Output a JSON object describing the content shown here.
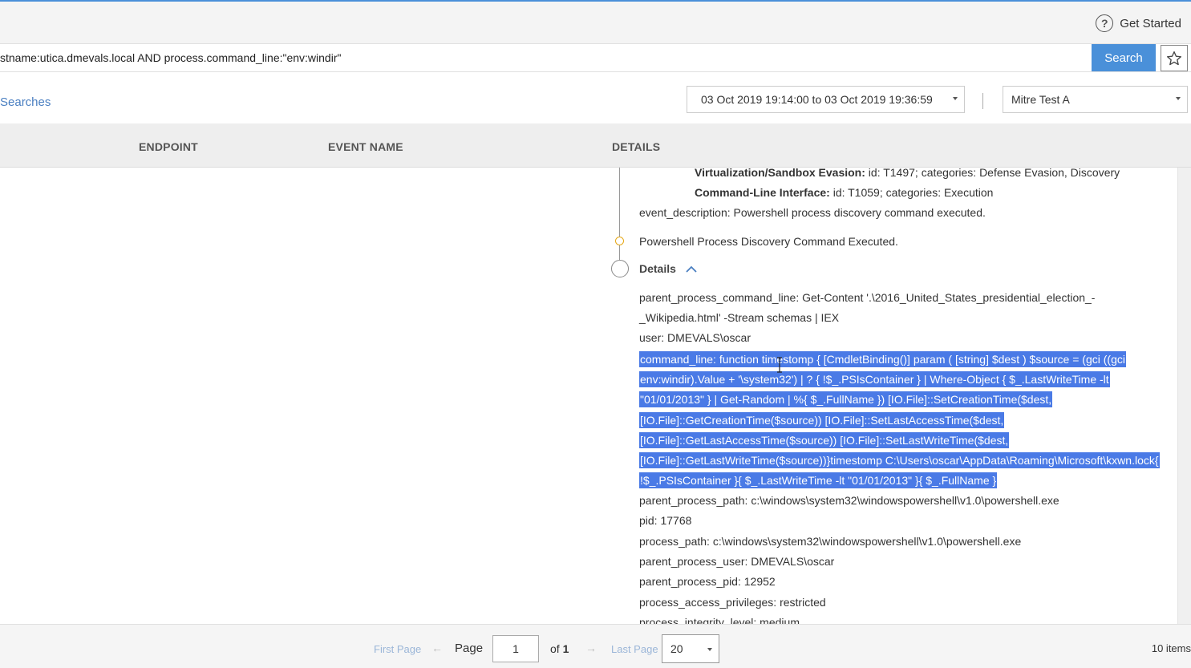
{
  "header": {
    "get_started_label": "Get Started",
    "help_glyph": "?"
  },
  "query": {
    "value": "stname:utica.dmevals.local AND process.command_line:\"env:windir\"",
    "search_label": "Search",
    "star_icon": "star-icon"
  },
  "filters": {
    "searches_link": "Searches",
    "date_range": "03 Oct 2019 19:14:00 to 03 Oct 2019 19:36:59",
    "tenant": "Mitre Test A"
  },
  "table": {
    "columns": [
      "ENDPOINT",
      "EVENT NAME",
      "DETAILS"
    ]
  },
  "details": {
    "technique_1_name": "Virtualization/Sandbox Evasion:",
    "technique_1_rest": " id: T1497; categories: Defense Evasion, Discovery",
    "technique_2_name": "Command-Line Interface:",
    "technique_2_rest": " id: T1059; categories: Execution",
    "event_description": "event_description:  Powershell process discovery command executed.",
    "event_title": "Powershell Process Discovery Command Executed.",
    "section_title": "Details",
    "ppcl_line1": "parent_process_command_line:  Get-Content '.\\2016_United_States_presidential_election_-",
    "ppcl_line2": "_Wikipedia.html' -Stream schemas | IEX",
    "user": "user:  DMEVALS\\oscar",
    "cmd_lines": [
      "command_line:  function timestomp { [CmdletBinding()] param ( [string] $dest ) $source = (gci ((gci",
      "env:windir).Value + '\\system32') | ? { !$_.PSIsContainer } | Where-Object { $_.LastWriteTime -lt",
      "\"01/01/2013\" } | Get-Random | %{ $_.FullName }) [IO.File]::SetCreationTime($dest,",
      "[IO.File]::GetCreationTime($source)) [IO.File]::SetLastAccessTime($dest,",
      "[IO.File]::GetLastAccessTime($source)) [IO.File]::SetLastWriteTime($dest,",
      "[IO.File]::GetLastWriteTime($source))}timestomp C:\\Users\\oscar\\AppData\\Roaming\\Microsoft\\kxwn.lock{",
      "!$_.PSIsContainer }{ $_.LastWriteTime -lt \"01/01/2013\" }{ $_.FullName }"
    ],
    "parent_process_path": "parent_process_path:  c:\\windows\\system32\\windowspowershell\\v1.0\\powershell.exe",
    "pid": "pid:  17768",
    "process_path": "process_path:  c:\\windows\\system32\\windowspowershell\\v1.0\\powershell.exe",
    "parent_process_user": "parent_process_user:  DMEVALS\\oscar",
    "parent_process_pid": "parent_process_pid:  12952",
    "process_access_privileges": "process_access_privileges:  restricted",
    "process_integrity_level": "process_integrity_level:  medium"
  },
  "footer": {
    "first_page": "First Page",
    "prev_arrow": "←",
    "page_label": "Page",
    "page_value": "1",
    "of_label": "of",
    "of_total": "1",
    "next_arrow": "→",
    "last_page": "Last Page",
    "page_size": "20",
    "items_count": "10 items"
  },
  "colors": {
    "accent": "#4a90d9",
    "selection": "#4a7ae6",
    "timeline_dot": "#e6a817",
    "link": "#4a7fc1"
  }
}
